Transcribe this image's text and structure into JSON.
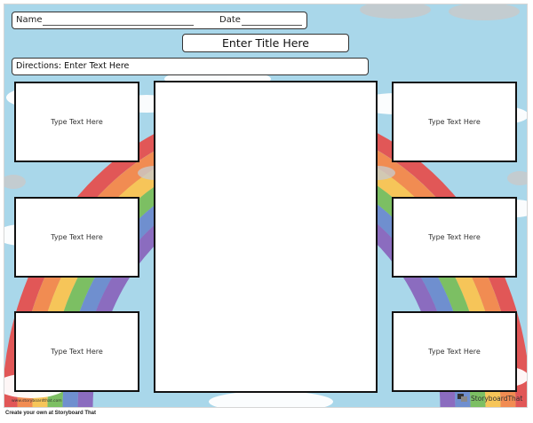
{
  "worksheet": {
    "name_label": "Name",
    "date_label": "Date",
    "title": "Enter Title Here",
    "directions": "Directions: Enter Text Here",
    "cells": {
      "left_1": "Type Text Here",
      "left_2": "Type Text Here",
      "left_3": "Type Text Here",
      "right_1": "Type Text Here",
      "right_2": "Type Text Here",
      "right_3": "Type Text Here",
      "center": ""
    },
    "watermark_url": "www.storyboardthat.com",
    "brand": "StoryboardThat"
  },
  "footer": {
    "text": "Create your own at Storyboard That"
  },
  "colors": {
    "sky": "#a9d7ea",
    "rainbow": [
      "#e15757",
      "#f18c52",
      "#f6c559",
      "#7cbf63",
      "#6f8fcf",
      "#8b6cbf"
    ],
    "cloud": "#ffffff",
    "cloud_gray": "#c9c9c9"
  }
}
